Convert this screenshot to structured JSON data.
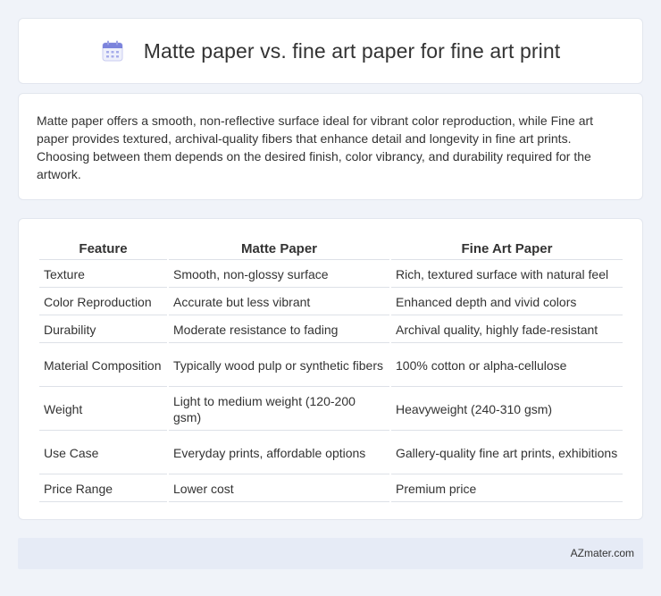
{
  "header": {
    "title": "Matte paper vs. fine art paper for fine art print",
    "icon": "calendar-icon"
  },
  "summary": {
    "text": "Matte paper offers a smooth, non-reflective surface ideal for vibrant color reproduction, while Fine art paper provides textured, archival-quality fibers that enhance detail and longevity in fine art prints. Choosing between them depends on the desired finish, color vibrancy, and durability required for the artwork."
  },
  "table": {
    "headers": [
      "Feature",
      "Matte Paper",
      "Fine Art Paper"
    ],
    "rows": [
      [
        "Texture",
        "Smooth, non-glossy surface",
        "Rich, textured surface with natural feel"
      ],
      [
        "Color Reproduction",
        "Accurate but less vibrant",
        "Enhanced depth and vivid colors"
      ],
      [
        "Durability",
        "Moderate resistance to fading",
        "Archival quality, highly fade-resistant"
      ],
      [
        "Material Composition",
        "Typically wood pulp or synthetic fibers",
        "100% cotton or alpha-cellulose"
      ],
      [
        "Weight",
        "Light to medium weight (120-200 gsm)",
        "Heavyweight (240-310 gsm)"
      ],
      [
        "Use Case",
        "Everyday prints, affordable options",
        "Gallery-quality fine art prints, exhibitions"
      ],
      [
        "Price Range",
        "Lower cost",
        "Premium price"
      ]
    ]
  },
  "footer": {
    "brand": "AZmater.com"
  },
  "colors": {
    "background": "#f0f3f9",
    "card": "#ffffff",
    "footer": "#e6ebf6",
    "icon_accent": "#6b74d6"
  }
}
